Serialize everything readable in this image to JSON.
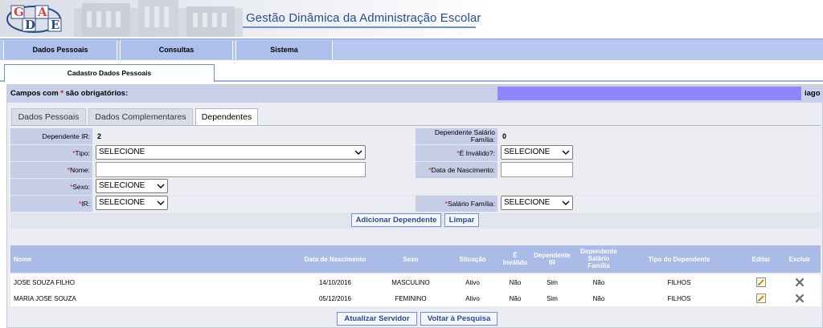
{
  "header": {
    "logo_letters": [
      "G",
      "D",
      "A",
      "E"
    ],
    "app_title": "Gestão Dinâmica da Administração Escolar"
  },
  "menu": [
    {
      "label": "Dados Pessoais"
    },
    {
      "label": "Consultas"
    },
    {
      "label": "Sistema"
    }
  ],
  "page_tab": {
    "label": "Cadastro Dados Pessoais"
  },
  "required_note": {
    "prefix": "Campos com ",
    "star": "*",
    "suffix": " são obrigatórios:"
  },
  "user": {
    "name_tail": "iago"
  },
  "subtabs": [
    {
      "label": "Dados Pessoais",
      "active": false
    },
    {
      "label": "Dados Complementares",
      "active": false
    },
    {
      "label": "Dependentes",
      "active": true
    }
  ],
  "form": {
    "dependente_ir": {
      "label": "Dependente IR:",
      "value": "2"
    },
    "dependente_salario_familia": {
      "label": "Dependente Salário Família:",
      "value": "0"
    },
    "tipo": {
      "label": "Tipo:",
      "value": "SELECIONE"
    },
    "e_invalido": {
      "label": "É Inválido?:",
      "value": "SELECIONE"
    },
    "nome": {
      "label": "Nome:",
      "value": ""
    },
    "data_nascimento": {
      "label": "Data de Nascimento:",
      "value": ""
    },
    "sexo": {
      "label": "Sexo:",
      "value": "SELECIONE"
    },
    "ir": {
      "label": "IR:",
      "value": "SELECIONE"
    },
    "salario_familia": {
      "label": "Salário Família:",
      "value": "SELECIONE"
    },
    "star": "*"
  },
  "buttons": {
    "adicionar": "Adicionar Dependente",
    "limpar": "Limpar",
    "atualizar": "Atualizar Servidor",
    "voltar": "Voltar à Pesquisa"
  },
  "table": {
    "headers": {
      "nome": "Nome",
      "data_nascimento": "Data de Nascimento",
      "sexo": "Sexo",
      "situacao": "Situação",
      "e_invalido": "É Inválido",
      "dependente_ir": "Dependente IR",
      "dependente_salario_familia": "Dependente Salário Família",
      "tipo_dependente": "Tipo do Dependente",
      "editar": "Editar",
      "excluir": "Excluir"
    },
    "rows": [
      {
        "nome": "JOSE SOUZA FILHO",
        "data_nascimento": "14/10/2016",
        "sexo": "MASCULINO",
        "situacao": "Ativo",
        "e_invalido": "Não",
        "dependente_ir": "Sim",
        "dependente_salario_familia": "Não",
        "tipo_dependente": "FILHOS"
      },
      {
        "nome": "MARIA JOSE SOUZA",
        "data_nascimento": "05/12/2016",
        "sexo": "FEMININO",
        "situacao": "Ativo",
        "e_invalido": "Não",
        "dependente_ir": "Sim",
        "dependente_salario_familia": "Não",
        "tipo_dependente": "FILHOS"
      }
    ]
  },
  "colors": {
    "accent_blue": "#2a4c8f",
    "menu_bg": "#adc0ec",
    "label_bg": "#c6cde6",
    "required_star": "#dd1111",
    "user_bar": "#8f86ff"
  }
}
